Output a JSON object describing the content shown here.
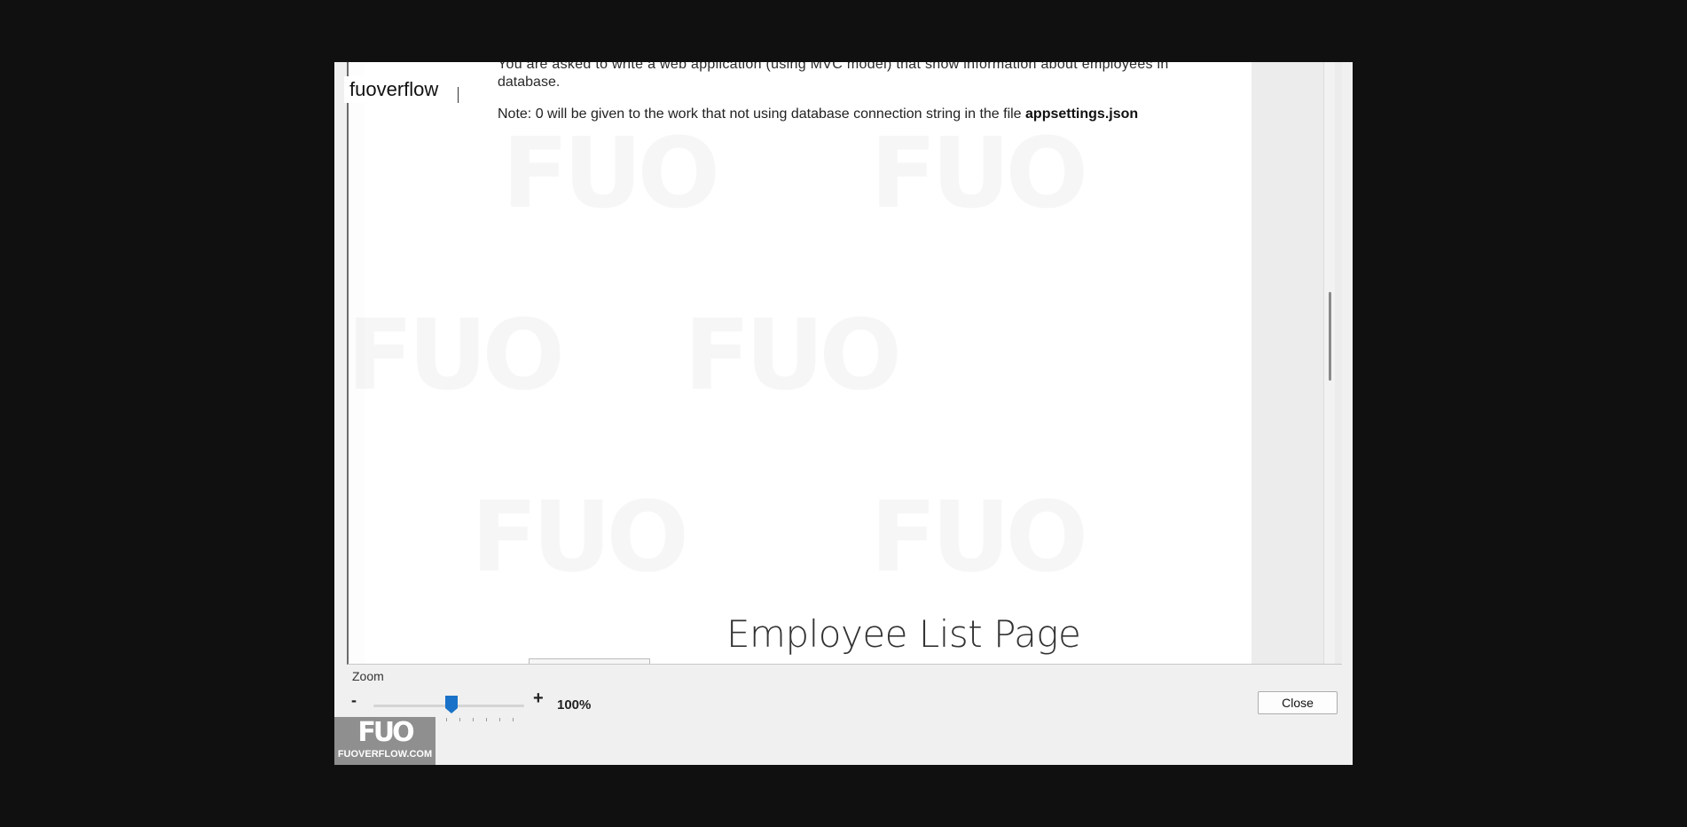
{
  "overlay": {
    "brand_label": "fuoverflow"
  },
  "document": {
    "paragraph_line1": "You are asked to write a web application (using MVC model) that show information about employees in",
    "paragraph_line2": "database.",
    "note_prefix": "Note: 0 will be given to the work that not using database connection string in the file ",
    "note_bold": "appsettings.json",
    "heading": "Employee List Page",
    "watermark_text": "FUO"
  },
  "zoom": {
    "label": "Zoom",
    "minus_label": "-",
    "plus_label": "+",
    "percent_text": "100%",
    "level_percent": 100
  },
  "buttons": {
    "close_label": "Close"
  },
  "logo": {
    "mark": "FUO",
    "text": "FUOVERFLOW.COM"
  },
  "colors": {
    "slider_thumb": "#1a72c8",
    "background": "#101010"
  }
}
